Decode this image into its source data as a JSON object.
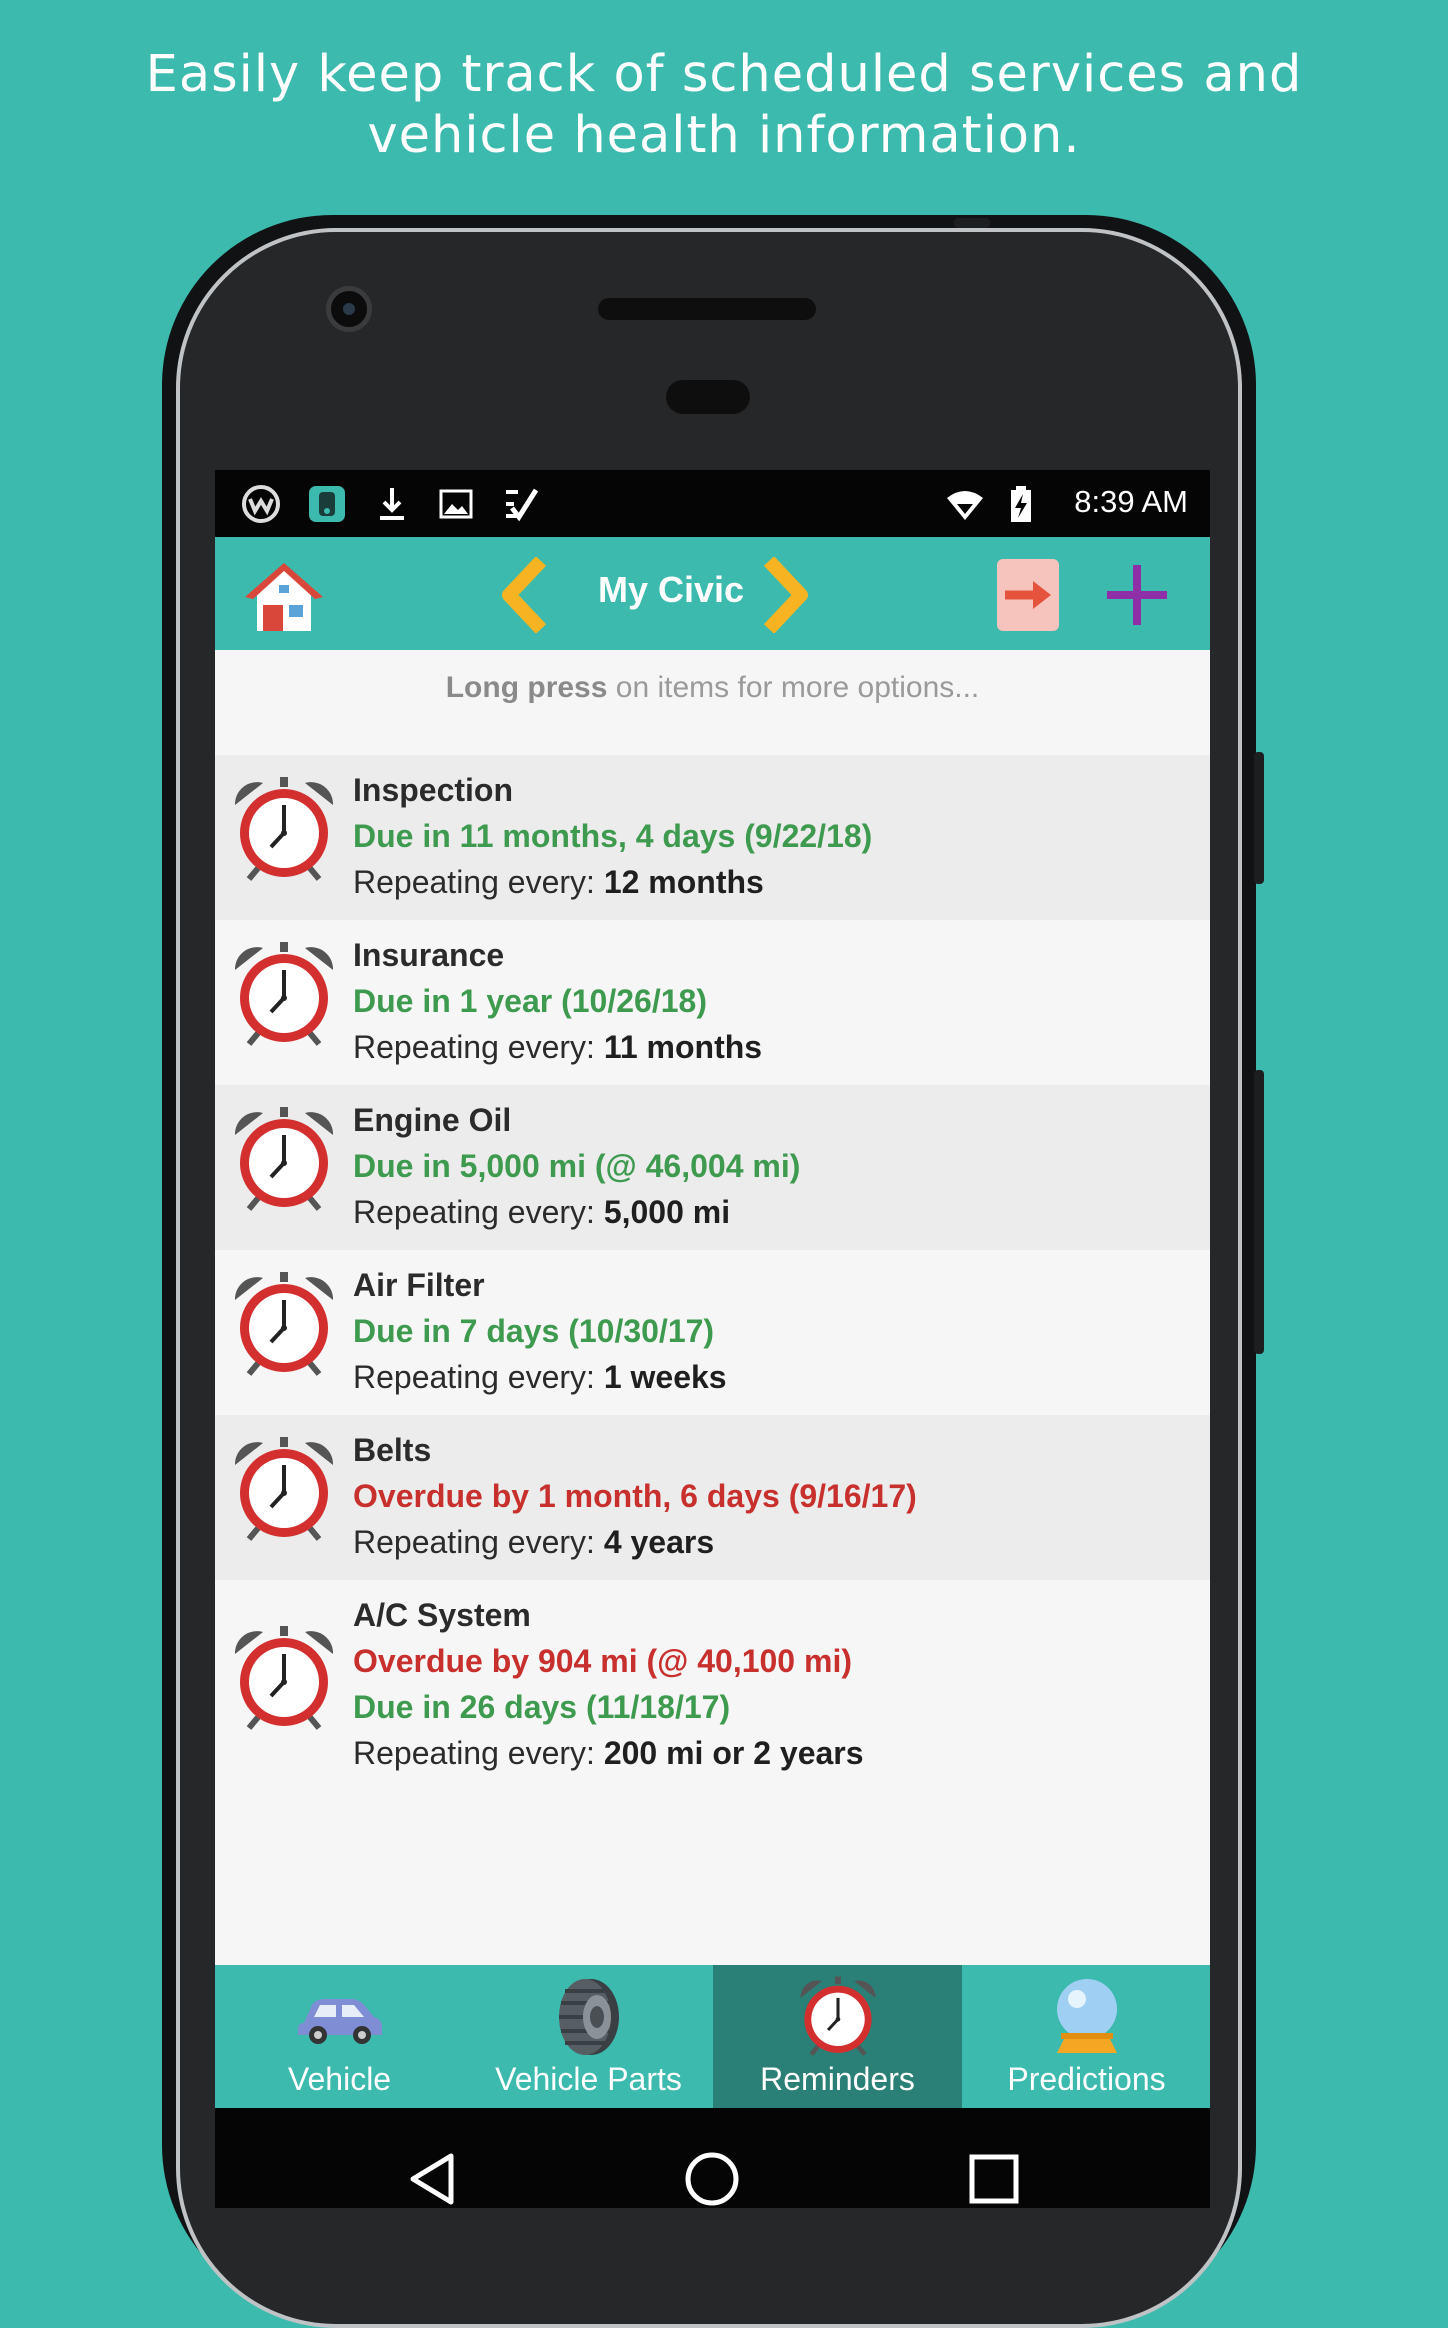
{
  "headline": {
    "line1": "Easily keep track of scheduled services and",
    "line2": "vehicle health information."
  },
  "status_bar": {
    "time": "8:39 AM",
    "icons": [
      "weather-icon",
      "app-icon",
      "download-icon",
      "image-icon",
      "checklist-icon",
      "wifi-icon",
      "battery-charging-icon"
    ]
  },
  "toolbar": {
    "title": "My Civic",
    "icons": [
      "home-icon",
      "chevron-left-icon",
      "chevron-right-icon",
      "export-icon",
      "add-icon"
    ]
  },
  "hint": {
    "bold": "Long press",
    "rest": " on items for more options..."
  },
  "reminders": [
    {
      "name": "Inspection",
      "due": "Due in 11 months, 4 days (9/22/18)",
      "repeat_label": "Repeating every: ",
      "repeat_value": "12 months"
    },
    {
      "name": "Insurance",
      "due": "Due in 1 year (10/26/18)",
      "repeat_label": "Repeating every: ",
      "repeat_value": "11 months"
    },
    {
      "name": "Engine Oil",
      "due": "Due in 5,000 mi (@ 46,004 mi)",
      "repeat_label": "Repeating every: ",
      "repeat_value": "5,000 mi"
    },
    {
      "name": "Air Filter",
      "due": "Due in 7 days (10/30/17)",
      "repeat_label": "Repeating every: ",
      "repeat_value": "1 weeks"
    },
    {
      "name": "Belts",
      "overdue": "Overdue by 1 month, 6 days (9/16/17)",
      "repeat_label": "Repeating every: ",
      "repeat_value": "4 years"
    },
    {
      "name": "A/C System",
      "overdue": "Overdue by 904 mi (@ 40,100 mi)",
      "due": "Due in 26 days (11/18/17)",
      "repeat_label": "Repeating every: ",
      "repeat_value": "200 mi or 2 years"
    }
  ],
  "bottom_nav": [
    {
      "label": "Vehicle",
      "icon": "car-icon"
    },
    {
      "label": "Vehicle Parts",
      "icon": "tire-icon"
    },
    {
      "label": "Reminders",
      "icon": "alarm-clock-icon",
      "active": true
    },
    {
      "label": "Predictions",
      "icon": "crystal-ball-icon"
    }
  ],
  "colors": {
    "background": "#3bbaad",
    "due_green": "#3e9a4f",
    "overdue_red": "#c8302e",
    "active_tab": "#2a8076"
  }
}
